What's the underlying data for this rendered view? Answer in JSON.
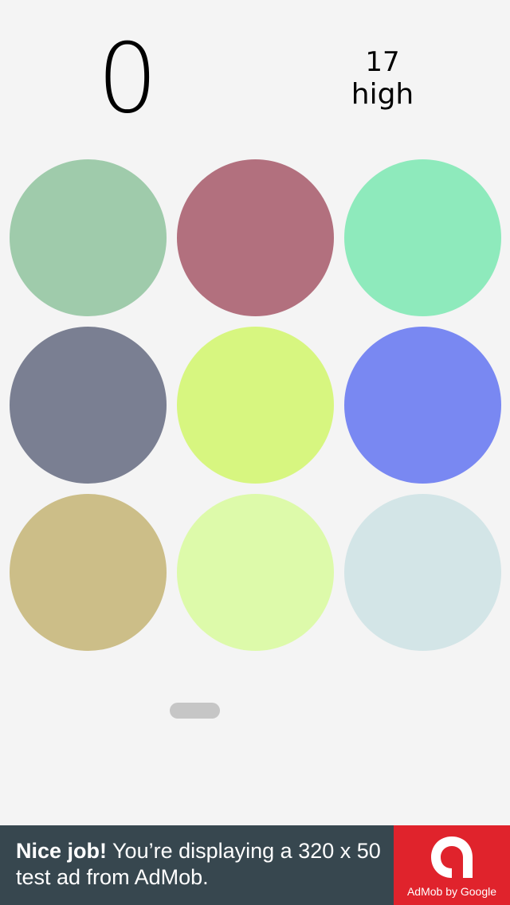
{
  "score": "0",
  "high": {
    "value": "17",
    "label": "high"
  },
  "circles": [
    {
      "name": "circle-r1c1",
      "color": "#9fcbab"
    },
    {
      "name": "circle-r1c2",
      "color": "#b2707e"
    },
    {
      "name": "circle-r1c3",
      "color": "#8eeabc"
    },
    {
      "name": "circle-r2c1",
      "color": "#7a7f92"
    },
    {
      "name": "circle-r2c2",
      "color": "#d7f680"
    },
    {
      "name": "circle-r2c3",
      "color": "#7988f2"
    },
    {
      "name": "circle-r3c1",
      "color": "#ccbe88"
    },
    {
      "name": "circle-r3c2",
      "color": "#ddfaaa"
    },
    {
      "name": "circle-r3c3",
      "color": "#d3e5e7"
    }
  ],
  "ad": {
    "bold_text": "Nice job!",
    "text": " You’re displaying a 320 x 50 test ad from AdMob.",
    "brand_label": "AdMob by Google",
    "logo_icon": "admob-logo-icon"
  }
}
